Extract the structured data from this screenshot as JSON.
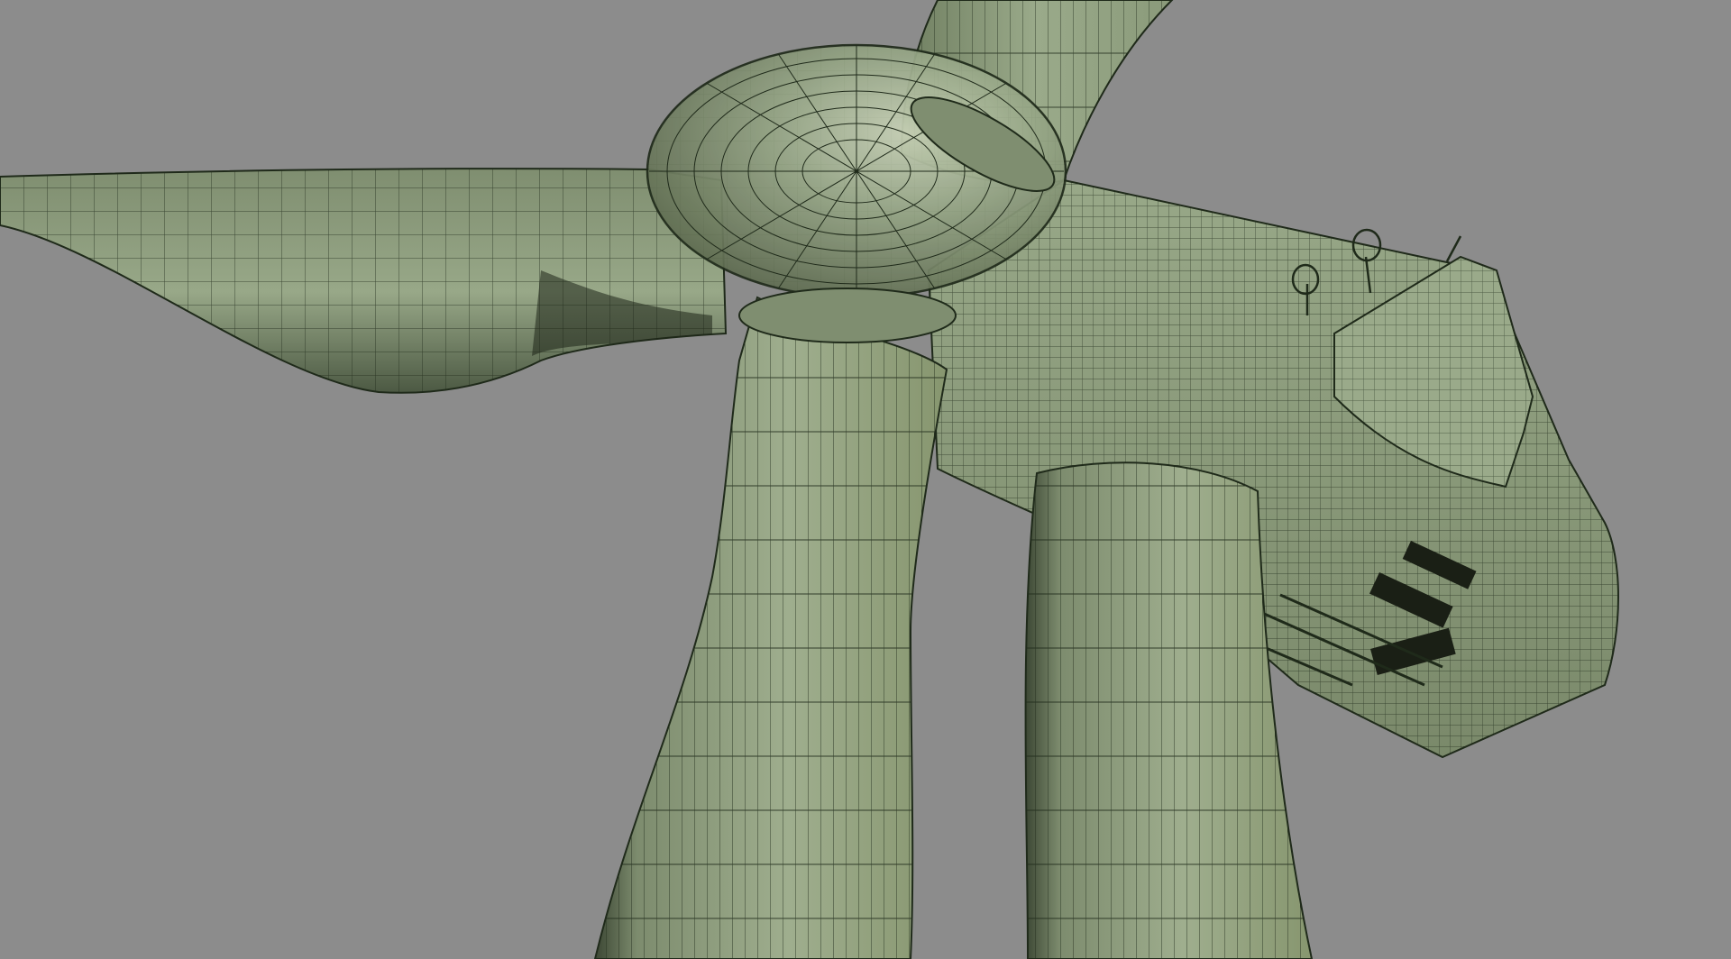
{
  "viewport": {
    "background_color": "#8c8c8c",
    "model_surface_color": "#8f9e80",
    "model_highlight_color": "#c8d2b6",
    "wireframe_color": "#1f2a1a",
    "shading_mode": "wireframe-on-shaded",
    "subject": "wind-turbine-3d-model"
  }
}
